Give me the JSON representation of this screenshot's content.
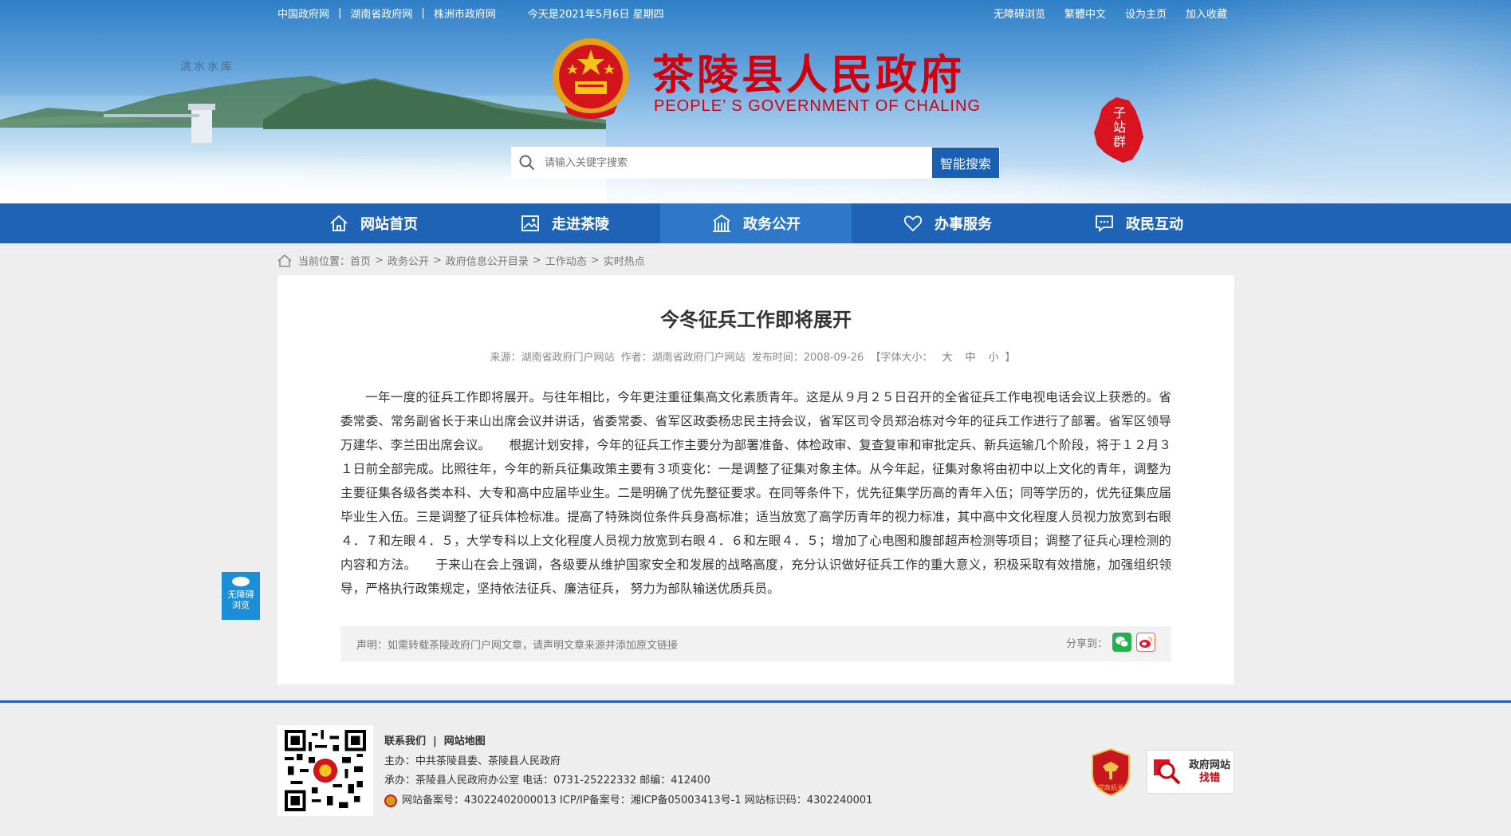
{
  "top_links": {
    "left": [
      "中国政府网",
      "湖南省政府网",
      "株洲市政府网"
    ],
    "separator": "|",
    "date": "今天是2021年5月6日 星期四",
    "right": [
      "无障碍浏览",
      "繁體中文",
      "设为主页",
      "加入收藏"
    ]
  },
  "banner": {
    "reservoir_label": "洮水水库",
    "title": "茶陵县人民政府",
    "subtitle": "PEOPLE’ S GOVERNMENT OF CHALING",
    "subsite_label": "子站群"
  },
  "search": {
    "placeholder": "请输入关键字搜索",
    "button": "智能搜索"
  },
  "nav": [
    {
      "label": "网站首页",
      "icon": "home-icon"
    },
    {
      "label": "走进茶陵",
      "icon": "picture-icon"
    },
    {
      "label": "政务公开",
      "icon": "building-icon",
      "active": true
    },
    {
      "label": "办事服务",
      "icon": "heart-icon"
    },
    {
      "label": "政民互动",
      "icon": "chat-icon"
    }
  ],
  "breadcrumb": {
    "prefix": "当前位置：",
    "items": [
      "首页",
      "政务公开",
      "政府信息公开目录",
      "工作动态",
      "实时热点"
    ],
    "separator": ">"
  },
  "article": {
    "title": "今冬征兵工作即将展开",
    "source": "来源：湖南省政府门户网站",
    "author": "作者：湖南省政府门户网站",
    "published": "发布时间：2008-09-26",
    "font_size_label": "【字体大小：",
    "font_sizes": [
      "大",
      "中",
      "小"
    ],
    "font_size_end": "】",
    "body": "一年一度的征兵工作即将展开。与往年相比，今年更注重征集高文化素质青年。这是从９月２５日召开的全省征兵工作电视电话会议上获悉的。省委常委、常务副省长于来山出席会议并讲话，省委常委、省军区政委杨忠民主持会议，省军区司令员郑治栋对今年的征兵工作进行了部署。省军区领导万建华、李兰田出席会议。　　根据计划安排，今年的征兵工作主要分为部署准备、体检政审、复查复审和审批定兵、新兵运输几个阶段，将于１２月３１日前全部完成。比照往年，今年的新兵征集政策主要有３项变化：一是调整了征集对象主体。从今年起，征集对象将由初中以上文化的青年，调整为主要征集各级各类本科、大专和高中应届毕业生。二是明确了优先整征要求。在同等条件下，优先征集学历高的青年入伍；同等学历的，优先征集应届毕业生入伍。三是调整了征兵体检标准。提高了特殊岗位条件兵身高标准；适当放宽了高学历青年的视力标准，其中高中文化程度人员视力放宽到右眼４．７和左眼４．５，大学专科以上文化程度人员视力放宽到右眼４．６和左眼４．５；增加了心电图和腹部超声检测等项目；调整了征兵心理检测的内容和方法。　　于来山在会上强调，各级要从维护国家安全和发展的战略高度，充分认识做好征兵工作的重大意义，积极采取有效措施，加强组织领导，严格执行政策规定，坚持依法征兵、廉洁征兵，  努力为部队输送优质兵员。",
    "statement": "声明：如需转载茶陵政府门户网文章，请声明文章来源并添加原文链接",
    "share_label": "分享到："
  },
  "float_accessibility": {
    "line1": "无障碍",
    "line2": "浏览"
  },
  "footer": {
    "links": [
      "联系我们",
      "网站地图"
    ],
    "sponsor": "主办：中共茶陵县委、茶陵县人民政府",
    "organizer": "承办：茶陵县人民政府办公室  电话：0731-25222332  邮编：412400",
    "record": "网站备案号：43022402000013  ICP/IP备案号：湘ICP备05003413号-1  网站标识码：4302240001",
    "badge_party_label": "党政机关",
    "err_line1": "政府网站",
    "err_line2": "找错"
  },
  "colors": {
    "nav_bg": "#1e63b6",
    "nav_active": "#2f77c7",
    "title_red": "#d1000f",
    "search_btn": "#1a5fb4"
  }
}
